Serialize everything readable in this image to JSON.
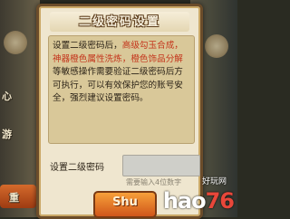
{
  "dialog": {
    "title": "二级密码设置",
    "body_parts": [
      {
        "text": "设置二级密码后，",
        "hl": false
      },
      {
        "text": "高级勾玉合成，神器橙色属性洗炼，橙色饰品分解",
        "hl": true
      },
      {
        "text": "等敏感操作需要验证二级密码后方可执行，可以有效保护您的账号安全，强烈建议设置密码。",
        "hl": false
      }
    ],
    "password_label": "设置二级密码",
    "password_value": "",
    "hint": "需要输入4位数字",
    "confirm_label": "Shu"
  },
  "background": {
    "left_labels": [
      "心",
      "游"
    ],
    "left_bottom_label": "重"
  },
  "watermark": {
    "brand_left": "hao",
    "brand_right": "76",
    "sub": "好玩网"
  },
  "colors": {
    "highlight": "#c4351c",
    "frame": "#6b4c2a",
    "panel": "#d9c899"
  }
}
